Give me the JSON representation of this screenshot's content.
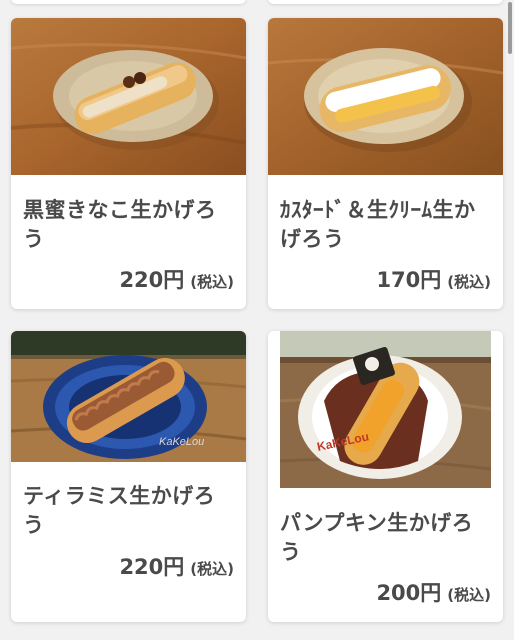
{
  "products": [
    {
      "name": "黒蜜きなこ生かげろう",
      "price": "220円",
      "tax": "(税込)",
      "image": "kuromitsu-kinako-kagerou-photo"
    },
    {
      "name": "ｶｽﾀｰﾄﾞ＆生ｸﾘｰﾑ生かげろう",
      "price": "170円",
      "tax": "(税込)",
      "image": "custard-cream-kagerou-photo"
    },
    {
      "name": "ティラミス生かげろう",
      "price": "220円",
      "tax": "(税込)",
      "image": "tiramisu-kagerou-photo"
    },
    {
      "name": "パンプキン生かげろう",
      "price": "200円",
      "tax": "(税込)",
      "image": "pumpkin-kagerou-photo"
    }
  ],
  "photo_logo_text": "KaKeLou"
}
